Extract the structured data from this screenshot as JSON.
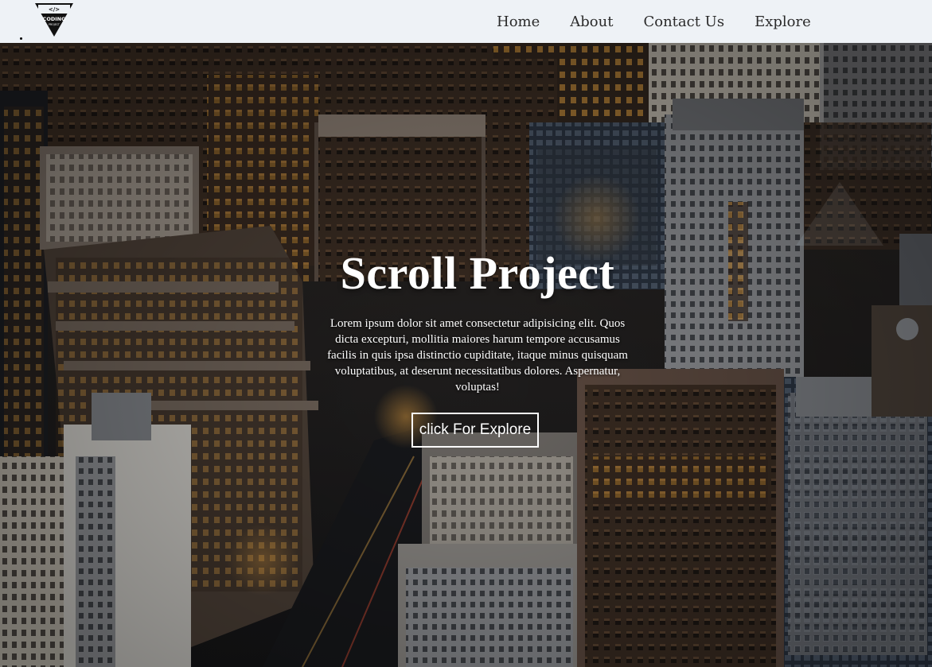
{
  "navbar": {
    "logo_icon": "coding-project-logo-icon",
    "logo_text": "CODING",
    "logo_subtext": "PROJECT",
    "links": [
      {
        "label": "Home"
      },
      {
        "label": "About"
      },
      {
        "label": "Contact Us"
      },
      {
        "label": "Explore"
      }
    ]
  },
  "hero": {
    "background": "aerial-city-skyline-image",
    "title": "Scroll Project",
    "text": "Lorem ipsum dolor sit amet consectetur adipisicing elit. Quos dicta excepturi, mollitia maiores harum tempore accusamus facilis in quis ipsa distinctio cupiditate, itaque minus quisquam voluptatibus, at deserunt necessitatibus dolores. Aspernatur, voluptas!",
    "button_label": "click For Explore"
  },
  "colors": {
    "navbar_bg": "#eef2f6",
    "nav_text": "#2b2b2b",
    "hero_text": "#ffffff"
  }
}
